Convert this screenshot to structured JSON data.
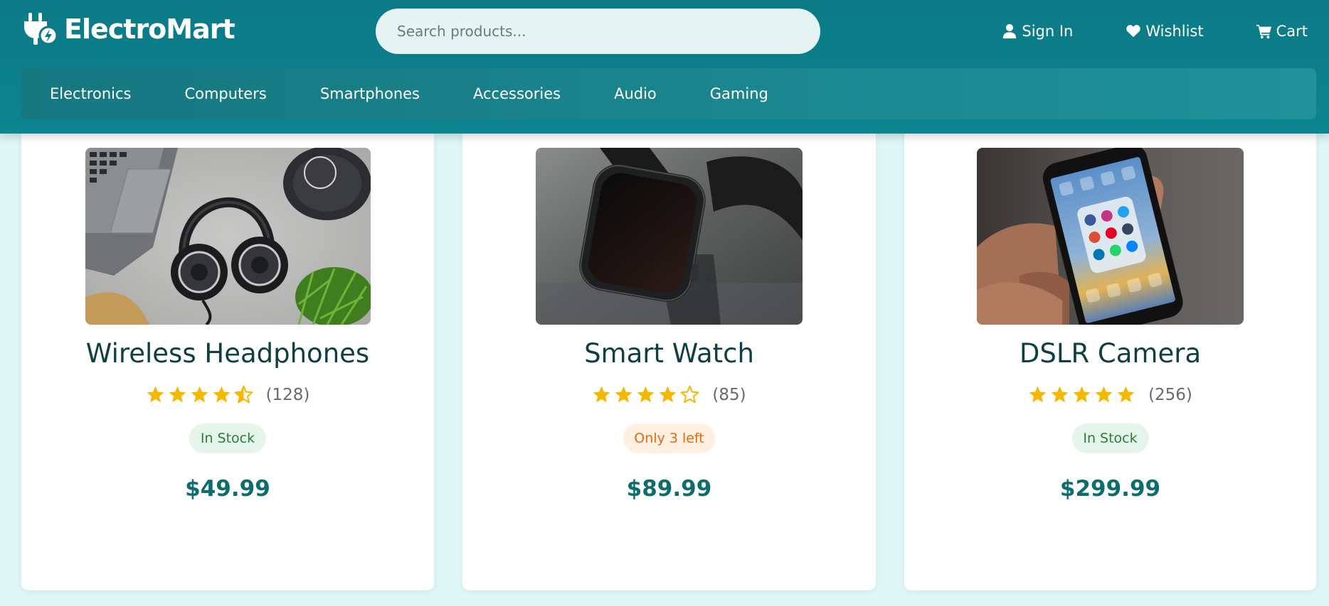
{
  "brand": {
    "name": "ElectroMart",
    "icon": "plug-bolt-icon"
  },
  "search": {
    "placeholder": "Search products..."
  },
  "top_actions": [
    {
      "label": "Sign In",
      "icon": "user-icon"
    },
    {
      "label": "Wishlist",
      "icon": "heart-icon"
    },
    {
      "label": "Cart",
      "icon": "cart-icon"
    }
  ],
  "nav": [
    "Electronics",
    "Computers",
    "Smartphones",
    "Accessories",
    "Audio",
    "Gaming"
  ],
  "colors": {
    "header": "#0b7a86",
    "star": "#f5b800",
    "price": "#0d6d6d",
    "in_stock": "#2d7a3c",
    "low_stock": "#e06d12"
  },
  "products": [
    {
      "title": "Wireless Headphones",
      "image": "headphones-photo",
      "rating": 4.5,
      "reviews": "(128)",
      "stock": "In Stock",
      "stock_status": "in-stock",
      "price": "$49.99"
    },
    {
      "title": "Smart Watch",
      "image": "smartwatch-photo",
      "rating": 4,
      "reviews": "(85)",
      "stock": "Only 3 left",
      "stock_status": "low-stock",
      "price": "$89.99"
    },
    {
      "title": "DSLR Camera",
      "image": "phone-photo",
      "rating": 5,
      "reviews": "(256)",
      "stock": "In Stock",
      "stock_status": "in-stock",
      "price": "$299.99"
    }
  ]
}
